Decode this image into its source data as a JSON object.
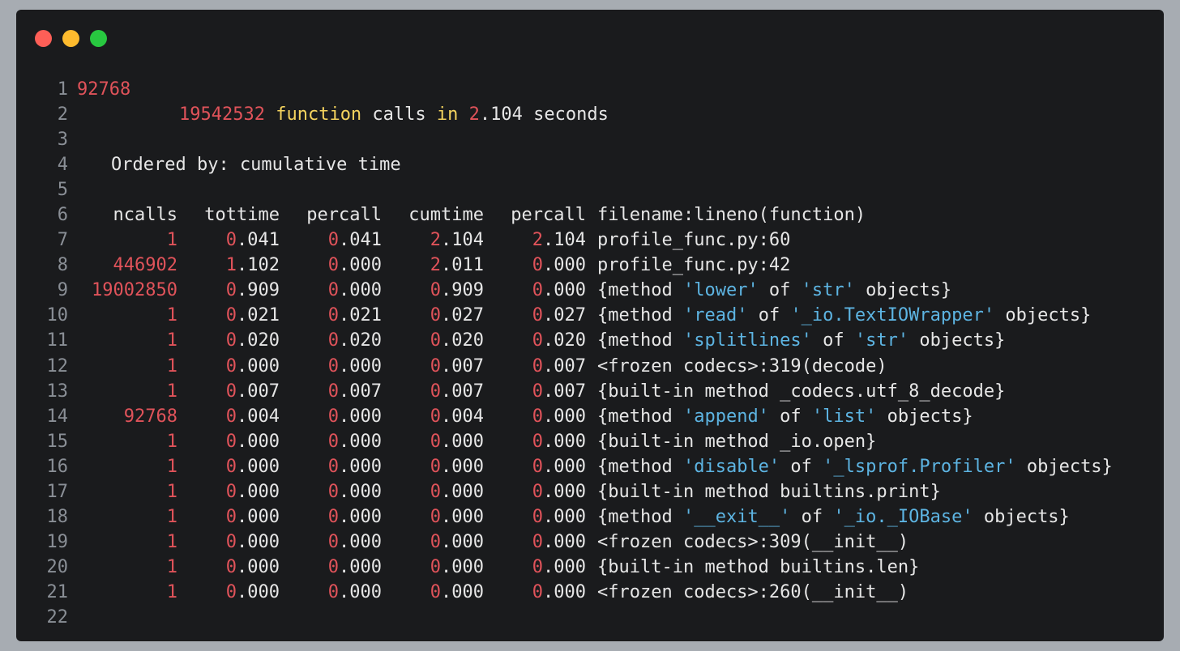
{
  "window": {
    "controls": [
      "close",
      "minimize",
      "maximize"
    ]
  },
  "colors": {
    "number": "#e0535a",
    "keyword": "#f4d35e",
    "string": "#5db4e2",
    "text": "#e6e6e6",
    "line_number": "#8a8f96",
    "background": "#1a1b1d"
  },
  "lines": [
    {
      "n": "1",
      "text": "92768"
    },
    {
      "n": "2",
      "calls": "19542532",
      "kw_function": "function",
      "calls_word": "calls",
      "kw_in": "in",
      "secs_int": "2",
      "secs_frac": ".104",
      "secs_word": "seconds"
    },
    {
      "n": "3"
    },
    {
      "n": "4",
      "text": "Ordered by: cumulative time"
    },
    {
      "n": "5"
    },
    {
      "n": "6",
      "header": [
        "ncalls",
        "tottime",
        "percall",
        "cumtime",
        "percall",
        "filename:lineno(function)"
      ]
    },
    {
      "n": "7",
      "row": {
        "ncalls": "1",
        "tottime": [
          "0",
          ".041"
        ],
        "percall1": [
          "0",
          ".041"
        ],
        "cumtime": [
          "2",
          ".104"
        ],
        "percall2": [
          "2",
          ".104"
        ],
        "fn": [
          {
            "t": "profile_func.py:60"
          }
        ]
      }
    },
    {
      "n": "8",
      "row": {
        "ncalls": "446902",
        "tottime": [
          "1",
          ".102"
        ],
        "percall1": [
          "0",
          ".000"
        ],
        "cumtime": [
          "2",
          ".011"
        ],
        "percall2": [
          "0",
          ".000"
        ],
        "fn": [
          {
            "t": "profile_func.py:42"
          }
        ]
      }
    },
    {
      "n": "9",
      "row": {
        "ncalls": "19002850",
        "tottime": [
          "0",
          ".909"
        ],
        "percall1": [
          "0",
          ".000"
        ],
        "cumtime": [
          "0",
          ".909"
        ],
        "percall2": [
          "0",
          ".000"
        ],
        "fn": [
          {
            "t": "{method "
          },
          {
            "s": "'lower'"
          },
          {
            "t": " of "
          },
          {
            "s": "'str'"
          },
          {
            "t": " objects}"
          }
        ]
      }
    },
    {
      "n": "10",
      "row": {
        "ncalls": "1",
        "tottime": [
          "0",
          ".021"
        ],
        "percall1": [
          "0",
          ".021"
        ],
        "cumtime": [
          "0",
          ".027"
        ],
        "percall2": [
          "0",
          ".027"
        ],
        "fn": [
          {
            "t": "{method "
          },
          {
            "s": "'read'"
          },
          {
            "t": " of "
          },
          {
            "s": "'_io.TextIOWrapper'"
          },
          {
            "t": " objects}"
          }
        ]
      }
    },
    {
      "n": "11",
      "row": {
        "ncalls": "1",
        "tottime": [
          "0",
          ".020"
        ],
        "percall1": [
          "0",
          ".020"
        ],
        "cumtime": [
          "0",
          ".020"
        ],
        "percall2": [
          "0",
          ".020"
        ],
        "fn": [
          {
            "t": "{method "
          },
          {
            "s": "'splitlines'"
          },
          {
            "t": " of "
          },
          {
            "s": "'str'"
          },
          {
            "t": " objects}"
          }
        ]
      }
    },
    {
      "n": "12",
      "row": {
        "ncalls": "1",
        "tottime": [
          "0",
          ".000"
        ],
        "percall1": [
          "0",
          ".000"
        ],
        "cumtime": [
          "0",
          ".007"
        ],
        "percall2": [
          "0",
          ".007"
        ],
        "fn": [
          {
            "t": "<frozen codecs>:319(decode)"
          }
        ]
      }
    },
    {
      "n": "13",
      "row": {
        "ncalls": "1",
        "tottime": [
          "0",
          ".007"
        ],
        "percall1": [
          "0",
          ".007"
        ],
        "cumtime": [
          "0",
          ".007"
        ],
        "percall2": [
          "0",
          ".007"
        ],
        "fn": [
          {
            "t": "{built-in method _codecs.utf_8_decode}"
          }
        ]
      }
    },
    {
      "n": "14",
      "row": {
        "ncalls": "92768",
        "tottime": [
          "0",
          ".004"
        ],
        "percall1": [
          "0",
          ".000"
        ],
        "cumtime": [
          "0",
          ".004"
        ],
        "percall2": [
          "0",
          ".000"
        ],
        "fn": [
          {
            "t": "{method "
          },
          {
            "s": "'append'"
          },
          {
            "t": " of "
          },
          {
            "s": "'list'"
          },
          {
            "t": " objects}"
          }
        ]
      }
    },
    {
      "n": "15",
      "row": {
        "ncalls": "1",
        "tottime": [
          "0",
          ".000"
        ],
        "percall1": [
          "0",
          ".000"
        ],
        "cumtime": [
          "0",
          ".000"
        ],
        "percall2": [
          "0",
          ".000"
        ],
        "fn": [
          {
            "t": "{built-in method _io.open}"
          }
        ]
      }
    },
    {
      "n": "16",
      "row": {
        "ncalls": "1",
        "tottime": [
          "0",
          ".000"
        ],
        "percall1": [
          "0",
          ".000"
        ],
        "cumtime": [
          "0",
          ".000"
        ],
        "percall2": [
          "0",
          ".000"
        ],
        "fn": [
          {
            "t": "{method "
          },
          {
            "s": "'disable'"
          },
          {
            "t": " of "
          },
          {
            "s": "'_lsprof.Profiler'"
          },
          {
            "t": " objects}"
          }
        ]
      }
    },
    {
      "n": "17",
      "row": {
        "ncalls": "1",
        "tottime": [
          "0",
          ".000"
        ],
        "percall1": [
          "0",
          ".000"
        ],
        "cumtime": [
          "0",
          ".000"
        ],
        "percall2": [
          "0",
          ".000"
        ],
        "fn": [
          {
            "t": "{built-in method builtins.print}"
          }
        ]
      }
    },
    {
      "n": "18",
      "row": {
        "ncalls": "1",
        "tottime": [
          "0",
          ".000"
        ],
        "percall1": [
          "0",
          ".000"
        ],
        "cumtime": [
          "0",
          ".000"
        ],
        "percall2": [
          "0",
          ".000"
        ],
        "fn": [
          {
            "t": "{method "
          },
          {
            "s": "'__exit__'"
          },
          {
            "t": " of "
          },
          {
            "s": "'_io._IOBase'"
          },
          {
            "t": " objects}"
          }
        ]
      }
    },
    {
      "n": "19",
      "row": {
        "ncalls": "1",
        "tottime": [
          "0",
          ".000"
        ],
        "percall1": [
          "0",
          ".000"
        ],
        "cumtime": [
          "0",
          ".000"
        ],
        "percall2": [
          "0",
          ".000"
        ],
        "fn": [
          {
            "t": "<frozen codecs>:309(__init__)"
          }
        ]
      }
    },
    {
      "n": "20",
      "row": {
        "ncalls": "1",
        "tottime": [
          "0",
          ".000"
        ],
        "percall1": [
          "0",
          ".000"
        ],
        "cumtime": [
          "0",
          ".000"
        ],
        "percall2": [
          "0",
          ".000"
        ],
        "fn": [
          {
            "t": "{built-in method builtins.len}"
          }
        ]
      }
    },
    {
      "n": "21",
      "row": {
        "ncalls": "1",
        "tottime": [
          "0",
          ".000"
        ],
        "percall1": [
          "0",
          ".000"
        ],
        "cumtime": [
          "0",
          ".000"
        ],
        "percall2": [
          "0",
          ".000"
        ],
        "fn": [
          {
            "t": "<frozen codecs>:260(__init__)"
          }
        ]
      }
    },
    {
      "n": "22"
    }
  ]
}
